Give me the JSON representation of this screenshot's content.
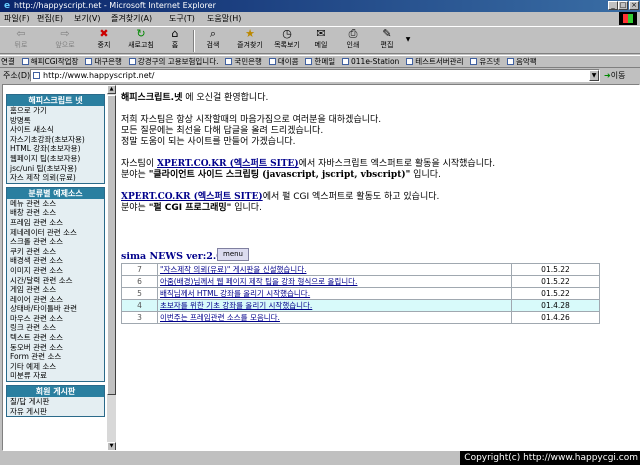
{
  "window": {
    "title": "http://happyscript.net - Microsoft Internet Explorer"
  },
  "menu": [
    "파일(F)",
    "편집(E)",
    "보기(V)",
    "즐겨찾기(A)",
    "도구(T)",
    "도움말(H)"
  ],
  "toolbar": {
    "back": "뒤로",
    "forward": "앞으로",
    "stop": "중지",
    "refresh": "새로고침",
    "home": "홈",
    "search": "검색",
    "favorites": "즐겨찾기",
    "history": "목록보기",
    "mail": "메일",
    "print": "인쇄",
    "edit": "편집"
  },
  "links": {
    "label": "연결",
    "items": [
      "해피CGI작업장",
      "대구은행",
      "강경구의 고용보험입니다.",
      "국민은행",
      "대이콤",
      "한메일",
      "011e-Station",
      "테스트서버관리",
      "유즈넷",
      "음악팩"
    ]
  },
  "address": {
    "label": "주소(D)",
    "url": "http://www.happyscript.net/",
    "go": "이동"
  },
  "sidebar": {
    "sections": [
      {
        "header": "해피스크립트 넷",
        "items": [
          "홈으로 가기",
          "방명록",
          "사이트 새소식",
          "자스기초강좌(초보자용)",
          "HTML 강좌(초보자용)",
          "웹페이지 팁(초보자용)",
          "jsc/uni 팁(초보자용)",
          "자스 제작 의뢰(유료)"
        ]
      },
      {
        "header": "분류별 예제소스",
        "items": [
          "메뉴 관련 소스",
          "배창 관련 소스",
          "프레임 관련 소스",
          "제네레이터 관련 소스",
          "스크롤 관련 소스",
          "쿠키 관련 소스",
          "배경색 관련 소스",
          "이미지 관련 소스",
          "시간/달력 관련 소스",
          "게임 관련 소스",
          "레이어 관련 소스",
          "상태바/타이틀바 관련",
          "마우스 관련 소스",
          "링크 관련 소스",
          "텍스트 관련 소스",
          "동오버 관련 소스",
          "Form 관련 소스",
          "기타 예제 소스",
          "미분류 자료"
        ]
      },
      {
        "header": "회원 게시판",
        "items": [
          "질/답 게시판",
          "자유 게시판"
        ]
      }
    ]
  },
  "main": {
    "welcome_site": "해피스크립트.넷",
    "welcome_rest": " 에 오신걸 환영합니다.",
    "intro_1": "저희 자스팀은 항상 시작할때의 마음가짐으로 여러분을 대하겠습니다.",
    "intro_2": "모든 질문에는 최선을 다해 답글을 올려 드리겠습니다.",
    "intro_3": "정말 도움이 되는 사이트를 만들어 가겠습니다.",
    "js_pre": "자스팀이 ",
    "xpert_link": "XPERT.CO.KR (엑스퍼트 SITE)",
    "js_post": "에서 자바스크립트 엑스퍼트로 활동을 시작했습니다.",
    "js_field_pre": "분야는 ",
    "js_field": "\"클라이언트 사이드 스크립팅 (javascript, jscript, vbscript)\"",
    "js_field_post": " 입니다.",
    "perl_link": "XPERT.CO.KR (엑스퍼트 SITE)",
    "perl_post": "에서 펄 CGI 엑스퍼트로 활동도 하고 있습니다.",
    "perl_field_pre": "분야는 ",
    "perl_field": "\"펄 CGI 프로그래밍\"",
    "perl_field_post": " 입니다."
  },
  "news": {
    "title": "sima NEWS ver:2.0",
    "menu_button": "menu",
    "rows": [
      {
        "num": "7",
        "subject": "\"자스제작 의뢰(유료)\" 게시판을 신설했습니다.",
        "date": "01.5.22"
      },
      {
        "num": "6",
        "subject": "아줌(배경)님께서 웹 페이지 제작 팁을 강좌 형식으로 올립니다.",
        "date": "01.5.22"
      },
      {
        "num": "5",
        "subject": "배직님께서 HTML 강좌를 올리기 시작했습니다.",
        "date": "01.5.22"
      },
      {
        "num": "4",
        "subject": "초보자를 위한 기초 강좌를 올리기 시작했습니다.",
        "date": "01.4.28"
      },
      {
        "num": "3",
        "subject": "이번주는 프레임관련 소스를 모음니다.",
        "date": "01.4.26"
      }
    ]
  },
  "copyright": "Copyright(c) http://www.happycgi.com"
}
